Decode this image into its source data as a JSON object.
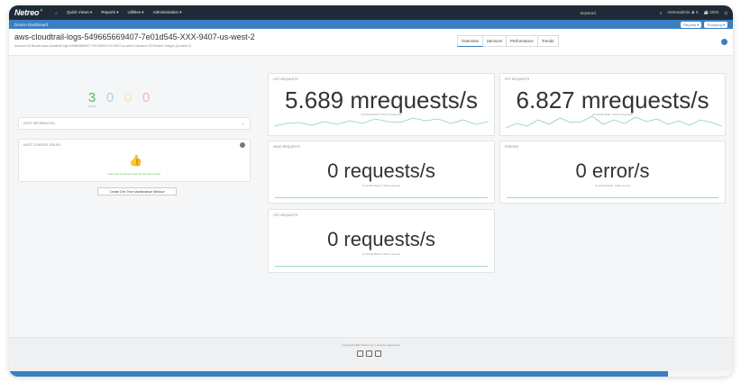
{
  "nav": {
    "logo": "Netreo",
    "items": [
      "Quick Views ▾",
      "Reports ▾",
      "Utilities ▾",
      "Administration ▾"
    ],
    "search_placeholder": "keyword",
    "user": "netreoadmin ♟ 5",
    "time": "☕ 2022"
  },
  "subbar": {
    "title": "Device Dashboard",
    "reports": "Reports ▾",
    "grouping": "Grouping ▾"
  },
  "device": {
    "name": "aws-cloudtrail-logs-549665669407-7e01d545-XXX-9407-us-west-2",
    "breadcrumbs": "Amazon S3 Bucket  aws-cloudtrail-logs-549665669407-7e01d545-XXX-9407-us-west-2  Amazon S3 Bucket  Oregon (us-west-2)"
  },
  "tabs": [
    "Overview",
    "Services",
    "Performance",
    "Trends"
  ],
  "status": {
    "counts": [
      {
        "value": "3",
        "label": "Normal",
        "color": "#5cb85c"
      },
      {
        "value": "0",
        "label": "",
        "color": "#a9d4f2"
      },
      {
        "value": "0",
        "label": "",
        "color": "#f3e3a3"
      },
      {
        "value": "0",
        "label": "",
        "color": "#f5b8b8"
      }
    ],
    "host_information": "HOST INFORMATION",
    "host_current_issues": "HOST CURRENT ISSUES",
    "no_issues": "There are no issues open at the current time.",
    "maintenance_button": "Create One Time Maintenance Window"
  },
  "metrics": {
    "list": {
      "label": "LIST REQUESTS",
      "value": "5.689 mrequests/s",
      "sub": "24 HOUR PEAK: 8.427 mrequests/s"
    },
    "put": {
      "label": "PUT REQUESTS",
      "value": "6.827 mrequests/s",
      "sub": "24 HOUR PEAK: 9.416 mrequests/s"
    },
    "head": {
      "label": "HEAD REQUESTS",
      "value": "0 requests/s",
      "sub": "24 HOUR PEAK: 0.000 requests/s"
    },
    "errors": {
      "label": "ERRORS",
      "value": "0 error/s",
      "sub": "24 HOUR PEAK: 0.000 errors/s"
    },
    "get": {
      "label": "GET REQUESTS",
      "value": "0 requests/s",
      "sub": "24 HOUR PEAK: 0.000 requests/s"
    }
  },
  "footer": {
    "copyright": "Copyright 2022 Netreo Inc. | License Agreement"
  }
}
